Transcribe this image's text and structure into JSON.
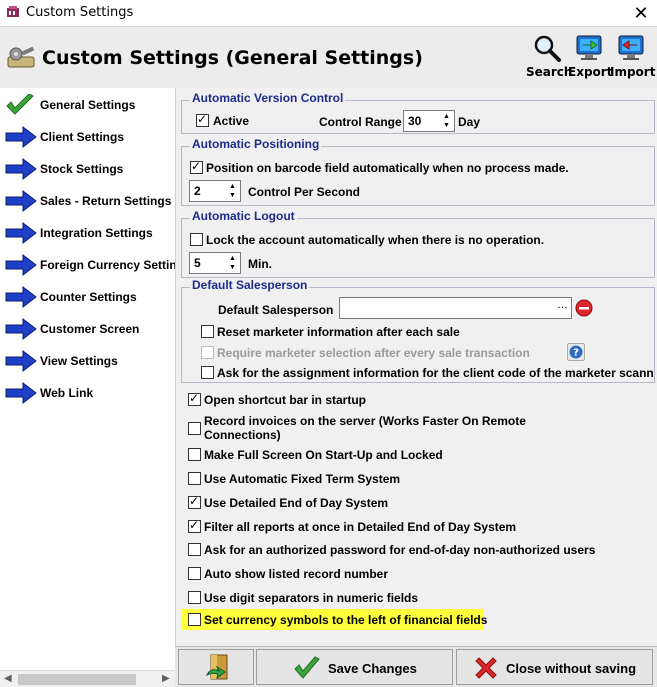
{
  "window": {
    "title": "Custom Settings",
    "close_glyph": "✕"
  },
  "header": {
    "title": "Custom Settings (General Settings)",
    "tools": [
      {
        "label": "Search",
        "icon": "magnifier-icon"
      },
      {
        "label": "Export",
        "icon": "export-monitor-icon"
      },
      {
        "label": "Import",
        "icon": "import-monitor-icon"
      }
    ]
  },
  "sidebar": {
    "items": [
      {
        "label": "General Settings",
        "icon": "checkmark-icon",
        "selected": true
      },
      {
        "label": "Client Settings",
        "icon": "arrow-right-icon"
      },
      {
        "label": "Stock Settings",
        "icon": "arrow-right-icon"
      },
      {
        "label": "Sales - Return Settings",
        "icon": "arrow-right-icon"
      },
      {
        "label": "Integration Settings",
        "icon": "arrow-right-icon"
      },
      {
        "label": "Foreign Currency Settings",
        "icon": "arrow-right-icon"
      },
      {
        "label": "Counter Settings",
        "icon": "arrow-right-icon"
      },
      {
        "label": "Customer Screen",
        "icon": "arrow-right-icon"
      },
      {
        "label": "View Settings",
        "icon": "arrow-right-icon"
      },
      {
        "label": "Web Link",
        "icon": "arrow-right-icon"
      }
    ]
  },
  "groups": {
    "version_control": {
      "title": "Automatic Version Control",
      "active_label": "Active",
      "active_checked": true,
      "control_range_label": "Control Range",
      "control_range_value": "30",
      "unit": "Day"
    },
    "positioning": {
      "title": "Automatic Positioning",
      "position_label": "Position on barcode field automatically when no process made.",
      "position_checked": true,
      "per_second_value": "2",
      "per_second_label": "Control Per Second"
    },
    "logout": {
      "title": "Automatic Logout",
      "lock_label": "Lock the account automatically when there is no operation.",
      "lock_checked": false,
      "minutes_value": "5",
      "minutes_label": "Min."
    },
    "salesperson": {
      "title": "Default Salesperson",
      "default_label": "Default Salesperson",
      "default_value": "",
      "reset_label": "Reset marketer information after each sale",
      "reset_checked": false,
      "require_label": "Require marketer selection after every sale transaction",
      "require_checked": false,
      "ask_label": "Ask for the assignment information for the client code of the marketer scanne"
    }
  },
  "options": [
    {
      "label": "Open shortcut bar in startup",
      "checked": true
    },
    {
      "label": "Record invoices on the server (Works Faster On Remote",
      "label2": "Connections)",
      "checked": false
    },
    {
      "label": "Make Full Screen On Start-Up and Locked",
      "checked": false
    },
    {
      "label": "Use Automatic Fixed Term System",
      "checked": false
    },
    {
      "label": "Use Detailed End of Day System",
      "checked": true
    },
    {
      "label": "Filter all reports at once in Detailed End of Day System",
      "checked": true
    },
    {
      "label": "Ask for an authorized password for end-of-day non-authorized users",
      "checked": false
    },
    {
      "label": "Auto show listed record number",
      "checked": false
    },
    {
      "label": "Use digit separators in numeric fields",
      "checked": false
    },
    {
      "label": "Set currency symbols to the left of financial fields",
      "checked": false,
      "highlighted": true
    }
  ],
  "footer": {
    "save_label": "Save Changes",
    "close_label": "Close without saving"
  },
  "colors": {
    "group_title": "#1d2b8a",
    "highlight": "#ffff3c",
    "arrow_blue": "#1e3fc8",
    "check_green": "#3aa53a",
    "cancel_red": "#e0262b"
  }
}
